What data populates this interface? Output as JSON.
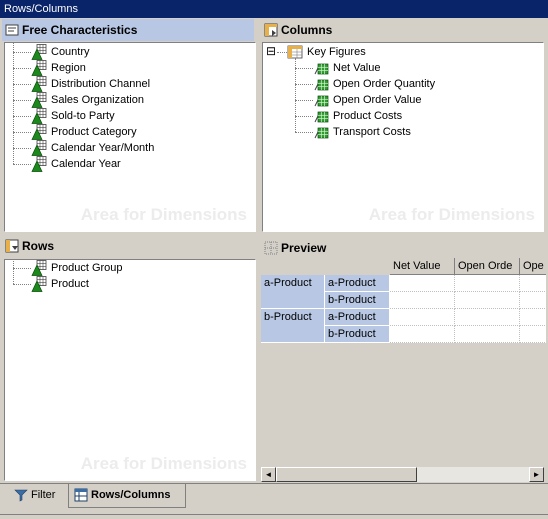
{
  "window": {
    "title": "Rows/Columns"
  },
  "free_characteristics": {
    "title": "Free Characteristics",
    "watermark": "Area for Dimensions",
    "items": [
      "Country",
      "Region",
      "Distribution Channel",
      "Sales Organization",
      "Sold-to Party",
      "Product Category",
      "Calendar Year/Month",
      "Calendar Year"
    ]
  },
  "columns": {
    "title": "Columns",
    "watermark": "Area for Dimensions",
    "root": "Key Figures",
    "root_toggle": "⊟",
    "items": [
      "Net Value",
      "Open Order Quantity",
      "Open Order Value",
      "Product Costs",
      "Transport Costs"
    ]
  },
  "rows": {
    "title": "Rows",
    "watermark": "Area for Dimensions",
    "items": [
      "Product Group",
      "Product"
    ]
  },
  "preview": {
    "title": "Preview",
    "column_headers": [
      "Net Value",
      "Open Orde",
      "Ope"
    ],
    "row_groups": [
      {
        "label": "a-Product",
        "sub": [
          "a-Product",
          "b-Product"
        ]
      },
      {
        "label": "b-Product",
        "sub": [
          "a-Product",
          "b-Product"
        ]
      }
    ],
    "scroll_left": "◄",
    "scroll_right": "►"
  },
  "tabs": [
    {
      "label": "Filter",
      "icon": "funnel-icon",
      "active": false
    },
    {
      "label": "Rows/Columns",
      "icon": "table-icon",
      "active": true
    }
  ],
  "colors": {
    "title_bar": "#0a246a",
    "selected_header": "#b8c8e4",
    "dimension_green": "#1a8a1a"
  }
}
